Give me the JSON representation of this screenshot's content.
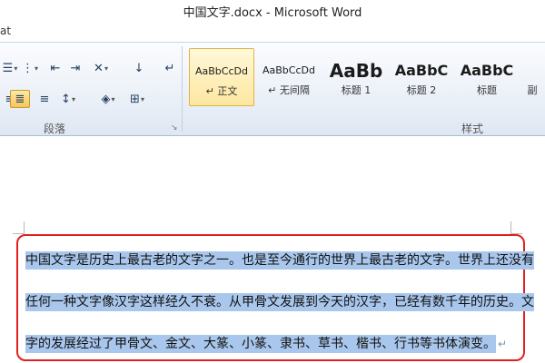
{
  "window": {
    "title": "中国文字.docx  -  Microsoft Word"
  },
  "ribbon": {
    "tab_partial": "at",
    "paragraph_group": {
      "label": "段落",
      "launcher": "↘"
    },
    "styles_group": {
      "label": "样式",
      "items": [
        {
          "sample": "AaBbCcDd",
          "name": "↵ 正文",
          "selected": true
        },
        {
          "sample": "AaBbCcDd",
          "name": "↵ 无间隔"
        },
        {
          "sample": "AaBb",
          "name": "标题 1"
        },
        {
          "sample": "AaBbC",
          "name": "标题 2"
        },
        {
          "sample": "AaBbC",
          "name": "标题"
        },
        {
          "sample": "",
          "name": "副"
        }
      ]
    }
  },
  "document": {
    "lines": [
      "中国文字是历史上最古老的文字之一。也是至今通行的世界上最古老的文字。世界上还没有",
      "任何一种文字像汉字这样经久不衰。从甲骨文发展到今天的汉字，已经有数千年的历史。文",
      "字的发展经过了甲骨文、金文、大篆、小篆、隶书、草书、楷书、行书等书体演变。"
    ],
    "end_mark": "↵"
  },
  "colors": {
    "selection": "#a9c7ec",
    "annotation_border": "#e0201d",
    "style_selected": "#fde7a0"
  }
}
